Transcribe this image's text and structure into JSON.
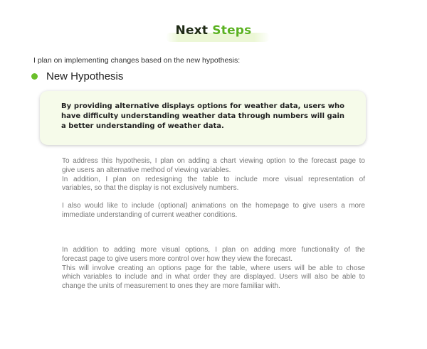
{
  "title": {
    "part1": "Next",
    "part2": "Steps",
    "accent_color": "#5bb221",
    "dark_color": "#1e2a14"
  },
  "intro": "I plan on implementing changes based on the new hypothesis:",
  "bullet": {
    "label": "New Hypothesis",
    "dot_color": "#6abf2a"
  },
  "hypothesis_card": {
    "text": "By providing alternative displays options for weather data, users who have difficulty understanding weather data through numbers will gain a better understanding of weather data.",
    "background": "#f6fbea"
  },
  "paragraphs": [
    {
      "lines": [
        "To address this hypothesis, I plan on adding a chart viewing option to the forecast page to",
        "give users an alternative method of viewing variables.",
        "In addition, I plan on redesigning the table to include more visual representation of",
        "variables, so that the display is not exclusively numbers."
      ]
    },
    {
      "lines": [
        "I also would like to include (optional) animations on the homepage to give users a more",
        "immediate understanding of current weather conditions."
      ]
    },
    {
      "lines": [
        "In addition to adding more visual options, I plan on adding more functionality of the",
        "forecast page to give users more control over how they view the forecast.",
        "This will involve creating an options page for the table, where users will be able to chose",
        "which variables to include and in what order they are displayed. Users will also be able to",
        "change the units of measurement to ones they are more familiar with."
      ]
    }
  ]
}
